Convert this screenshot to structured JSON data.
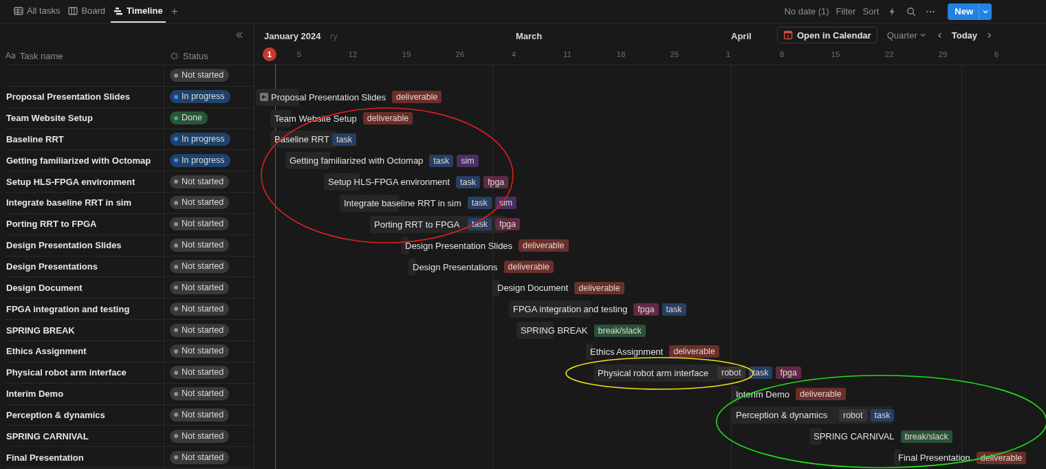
{
  "tabs": [
    {
      "label": "All tasks",
      "kind": "table",
      "selected": false
    },
    {
      "label": "Board",
      "kind": "board",
      "selected": false
    },
    {
      "label": "Timeline",
      "kind": "timeline",
      "selected": true
    }
  ],
  "add_tab": "+",
  "toolbar": {
    "no_date": "No date (1)",
    "filter": "Filter",
    "sort": "Sort",
    "new_button": "New"
  },
  "table": {
    "columns": [
      {
        "label": "Task name",
        "prefix": "Aa"
      },
      {
        "label": "Status"
      }
    ]
  },
  "timeline": {
    "months": [
      "January 2024",
      "ry",
      "March",
      "April"
    ],
    "days": [
      {
        "label": "1",
        "today": true
      },
      {
        "label": "5",
        "today": false
      },
      {
        "label": "12",
        "today": false
      },
      {
        "label": "19",
        "today": false
      },
      {
        "label": "26",
        "today": false
      },
      {
        "label": "4",
        "today": false
      },
      {
        "label": "11",
        "today": false
      },
      {
        "label": "18",
        "today": false
      },
      {
        "label": "25",
        "today": false
      },
      {
        "label": "1",
        "today": false
      },
      {
        "label": "8",
        "today": false
      },
      {
        "label": "15",
        "today": false
      },
      {
        "label": "22",
        "today": false
      },
      {
        "label": "29",
        "today": false
      },
      {
        "label": "6",
        "today": false
      }
    ],
    "open_calendar": "Open in Calendar",
    "scale": "Quarter",
    "today": "Today"
  },
  "rows": [
    {
      "status": {
        "label": "Not started",
        "kind": "not_started"
      }
    },
    {
      "name": "Proposal Presentation Slides",
      "status": {
        "label": "In progress",
        "kind": "in_progress"
      },
      "bar": {
        "label": "Proposal Presentation Slides",
        "starts_before": true,
        "tags": [
          {
            "label": "deliverable",
            "color": "#6b2f2a"
          }
        ]
      }
    },
    {
      "name": "Team Website Setup",
      "status": {
        "label": "Done",
        "kind": "done"
      },
      "bar": {
        "label": "Team Website Setup",
        "starts_before": false,
        "tags": [
          {
            "label": "deliverable",
            "color": "#6b2f2a"
          }
        ]
      }
    },
    {
      "name": "Baseline RRT",
      "status": {
        "label": "In progress",
        "kind": "in_progress"
      },
      "bar": {
        "label": "Baseline RRT",
        "starts_before": false,
        "tags": [
          {
            "label": "task",
            "color": "#263f63"
          }
        ]
      }
    },
    {
      "name": "Getting familiarized with Octomap",
      "status": {
        "label": "In progress",
        "kind": "in_progress"
      },
      "bar": {
        "label": "Getting familiarized with Octomap",
        "starts_before": false,
        "tags": [
          {
            "label": "task",
            "color": "#263f63"
          },
          {
            "label": "sim",
            "color": "#482f64"
          }
        ]
      }
    },
    {
      "name": "Setup HLS-FPGA environment",
      "status": {
        "label": "Not started",
        "kind": "not_started"
      },
      "bar": {
        "label": "Setup HLS-FPGA environment",
        "starts_before": false,
        "tags": [
          {
            "label": "task",
            "color": "#263f63"
          },
          {
            "label": "fpga",
            "color": "#5e2a44"
          }
        ]
      }
    },
    {
      "name": "Integrate baseline RRT in sim",
      "status": {
        "label": "Not started",
        "kind": "not_started"
      },
      "bar": {
        "label": "Integrate baseline RRT in sim",
        "starts_before": false,
        "tags": [
          {
            "label": "task",
            "color": "#263f63"
          },
          {
            "label": "sim",
            "color": "#482f64"
          }
        ]
      }
    },
    {
      "name": "Porting RRT to FPGA",
      "status": {
        "label": "Not started",
        "kind": "not_started"
      },
      "bar": {
        "label": "Porting RRT to FPGA",
        "starts_before": false,
        "tags": [
          {
            "label": "task",
            "color": "#263f63"
          },
          {
            "label": "fpga",
            "color": "#5e2a44"
          }
        ]
      }
    },
    {
      "name": "Design Presentation Slides",
      "status": {
        "label": "Not started",
        "kind": "not_started"
      },
      "bar": {
        "label": "Design Presentation Slides",
        "starts_before": false,
        "tags": [
          {
            "label": "deliverable",
            "color": "#6b2f2a"
          }
        ]
      }
    },
    {
      "name": "Design Presentations",
      "status": {
        "label": "Not started",
        "kind": "not_started"
      },
      "bar": {
        "label": "Design Presentations",
        "starts_before": false,
        "tags": [
          {
            "label": "deliverable",
            "color": "#6b2f2a"
          }
        ]
      }
    },
    {
      "name": "Design Document",
      "status": {
        "label": "Not started",
        "kind": "not_started"
      },
      "bar": {
        "label": "Design Document",
        "starts_before": false,
        "tags": [
          {
            "label": "deliverable",
            "color": "#6b2f2a"
          }
        ]
      }
    },
    {
      "name": "FPGA integration and testing",
      "status": {
        "label": "Not started",
        "kind": "not_started"
      },
      "bar": {
        "label": "FPGA integration and testing",
        "starts_before": false,
        "tags": [
          {
            "label": "fpga",
            "color": "#5e2a44"
          },
          {
            "label": "task",
            "color": "#263f63"
          }
        ]
      }
    },
    {
      "name": "SPRING BREAK",
      "status": {
        "label": "Not started",
        "kind": "not_started"
      },
      "bar": {
        "label": "SPRING BREAK",
        "starts_before": false,
        "tags": [
          {
            "label": "break/slack",
            "color": "#2a5238"
          }
        ]
      }
    },
    {
      "name": "Ethics Assignment",
      "status": {
        "label": "Not started",
        "kind": "not_started"
      },
      "bar": {
        "label": "Ethics Assignment",
        "starts_before": false,
        "tags": [
          {
            "label": "deliverable",
            "color": "#6b2f2a"
          }
        ]
      }
    },
    {
      "name": "Physical robot arm interface",
      "status": {
        "label": "Not started",
        "kind": "not_started"
      },
      "bar": {
        "label": "Physical robot arm interface",
        "starts_before": false,
        "tags": [
          {
            "label": "robot",
            "color": "#353535"
          },
          {
            "label": "task",
            "color": "#263f63"
          },
          {
            "label": "fpga",
            "color": "#5e2a44"
          }
        ]
      }
    },
    {
      "name": "Interim Demo",
      "status": {
        "label": "Not started",
        "kind": "not_started"
      },
      "bar": {
        "label": "Interim Demo",
        "starts_before": false,
        "tags": [
          {
            "label": "deliverable",
            "color": "#6b2f2a"
          }
        ]
      }
    },
    {
      "name": "Perception & dynamics",
      "status": {
        "label": "Not started",
        "kind": "not_started"
      },
      "bar": {
        "label": "Perception & dynamics",
        "starts_before": false,
        "tags": [
          {
            "label": "robot",
            "color": "#353535"
          },
          {
            "label": "task",
            "color": "#263f63"
          }
        ]
      }
    },
    {
      "name": "SPRING CARNIVAL",
      "status": {
        "label": "Not started",
        "kind": "not_started"
      },
      "bar": {
        "label": "SPRING CARNIVAL",
        "starts_before": false,
        "tags": [
          {
            "label": "break/slack",
            "color": "#2a5238"
          }
        ]
      }
    },
    {
      "name": "Final Presentation",
      "status": {
        "label": "Not started",
        "kind": "not_started"
      },
      "bar": {
        "label": "Final Presentation",
        "starts_before": false,
        "tags": [
          {
            "label": "deliverable",
            "color": "#6b2f2a"
          }
        ]
      }
    }
  ],
  "annotations": [
    {
      "kind": "ellipse",
      "color": "#e0201b"
    },
    {
      "kind": "ellipse",
      "color": "#f2e21c"
    },
    {
      "kind": "ellipse",
      "color": "#22e01b"
    }
  ]
}
